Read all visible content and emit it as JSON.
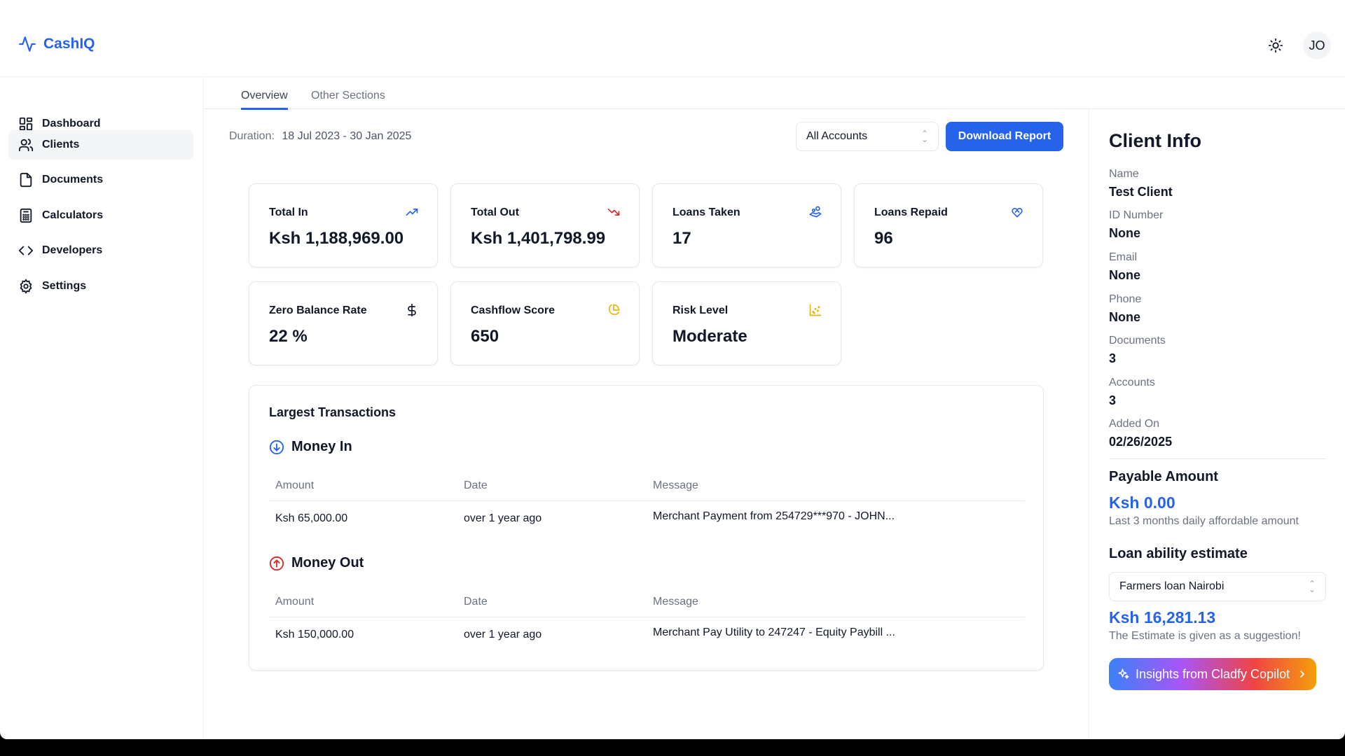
{
  "app": {
    "name": "CashIQ",
    "accent": "#2563eb"
  },
  "header": {
    "avatar_initials": "JO",
    "theme_icon": "sun-icon"
  },
  "sidebar": {
    "items": [
      {
        "label": "Dashboard",
        "icon": "dashboard-icon",
        "active": false
      },
      {
        "label": "Clients",
        "icon": "users-icon",
        "active": true
      },
      {
        "label": "Documents",
        "icon": "document-icon",
        "active": false
      },
      {
        "label": "Calculators",
        "icon": "calculator-icon",
        "active": false
      },
      {
        "label": "Developers",
        "icon": "code-icon",
        "active": false
      },
      {
        "label": "Settings",
        "icon": "gear-icon",
        "active": false
      }
    ]
  },
  "tabs": [
    {
      "label": "Overview",
      "active": true
    },
    {
      "label": "Other Sections",
      "active": false
    }
  ],
  "toolbar": {
    "duration_label": "Duration:",
    "duration_value": "18 Jul 2023 - 30 Jan 2025",
    "account_select": "All Accounts",
    "download_label": "Download Report"
  },
  "stats": [
    {
      "label": "Total In",
      "value": "Ksh 1,188,969.00",
      "icon": "trending-up-icon",
      "color": "#2563eb"
    },
    {
      "label": "Total Out",
      "value": "Ksh 1,401,798.99",
      "icon": "trending-down-icon",
      "color": "#dc2626"
    },
    {
      "label": "Loans Taken",
      "value": "17",
      "icon": "hand-coins-icon",
      "color": "#2563eb"
    },
    {
      "label": "Loans Repaid",
      "value": "96",
      "icon": "handshake-icon",
      "color": "#2563eb"
    },
    {
      "label": "Zero Balance Rate",
      "value": "22 %",
      "icon": "dollar-icon",
      "color": "#111827"
    },
    {
      "label": "Cashflow Score",
      "value": "650",
      "icon": "pie-chart-icon",
      "color": "#eab308"
    },
    {
      "label": "Risk Level",
      "value": "Moderate",
      "icon": "scatter-chart-icon",
      "color": "#eab308"
    }
  ],
  "transactions": {
    "title": "Largest Transactions",
    "columns": [
      "Amount",
      "Date",
      "Message"
    ],
    "money_in": {
      "label": "Money In",
      "rows": [
        {
          "amount": "Ksh 65,000.00",
          "date": "over 1 year ago",
          "message": "Merchant Payment from 254729***970 - JOHN..."
        }
      ]
    },
    "money_out": {
      "label": "Money Out",
      "rows": [
        {
          "amount": "Ksh 150,000.00",
          "date": "over 1 year ago",
          "message": "Merchant Pay Utility to 247247 - Equity Paybill ..."
        }
      ]
    }
  },
  "client_info": {
    "title": "Client Info",
    "fields": [
      {
        "label": "Name",
        "value": "Test Client"
      },
      {
        "label": "ID Number",
        "value": "None"
      },
      {
        "label": "Email",
        "value": "None"
      },
      {
        "label": "Phone",
        "value": "None"
      },
      {
        "label": "Documents",
        "value": "3"
      },
      {
        "label": "Accounts",
        "value": "3"
      },
      {
        "label": "Added On",
        "value": "02/26/2025"
      }
    ],
    "payable": {
      "title": "Payable Amount",
      "amount": "Ksh 0.00",
      "note": "Last 3 months daily affordable amount"
    },
    "loan": {
      "title": "Loan ability estimate",
      "product": "Farmers loan Nairobi",
      "amount": "Ksh 16,281.13",
      "note": "The Estimate is given as a suggestion!"
    },
    "copilot_label": "Insights from Cladfy Copilot"
  }
}
